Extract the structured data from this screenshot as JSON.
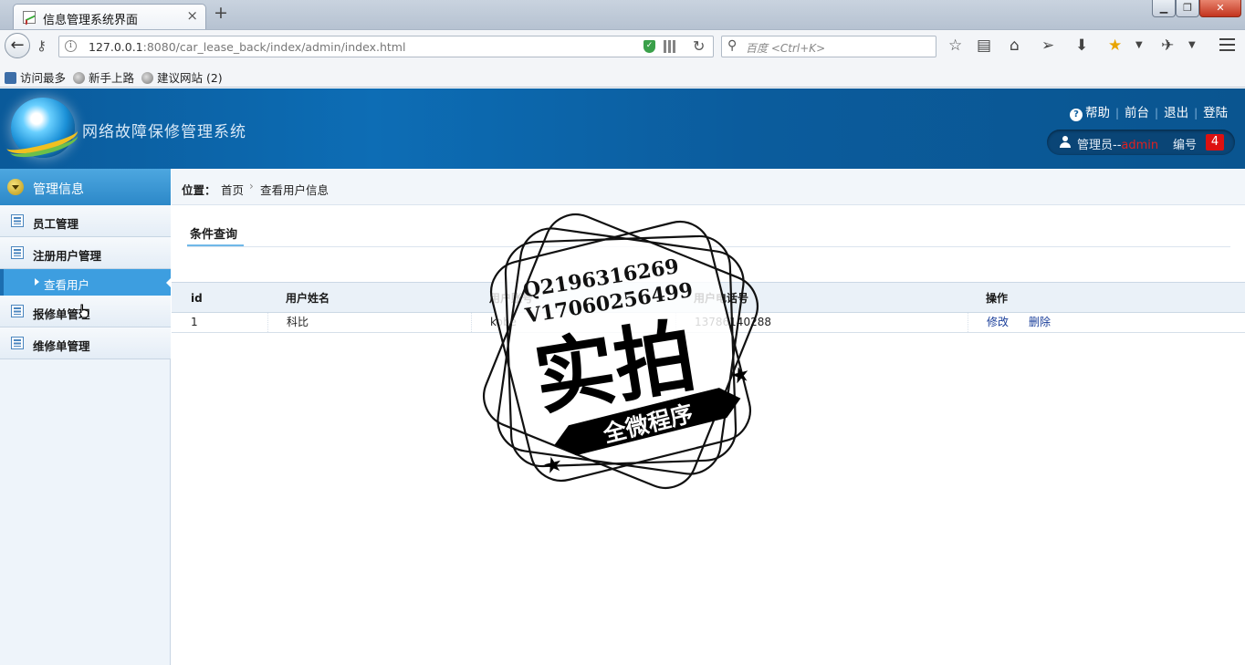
{
  "browser": {
    "tab_title": "信息管理系统界面",
    "tab_close": "×",
    "new_tab": "+",
    "url_host": "127.0.0.1",
    "url_rest": ":8080/car_lease_back/index/admin/index.html",
    "search_placeholder": "百度 <Ctrl+K>",
    "bookmarks": [
      "访问最多",
      "新手上路",
      "建议网站 (2)"
    ]
  },
  "header": {
    "title": "网络故障保修管理系统",
    "links": [
      "帮助",
      "前台",
      "退出",
      "登陆"
    ],
    "user_role": "管理员--",
    "user_name": "admin",
    "user_number_label": "编号",
    "user_number": "4"
  },
  "sidebar": {
    "title": "管理信息",
    "items": [
      {
        "label": "员工管理"
      },
      {
        "label": "注册用户管理"
      },
      {
        "label": "报修单管理"
      },
      {
        "label": "维修单管理"
      }
    ],
    "active_sub": "查看用户"
  },
  "breadcrumb": {
    "label": "位置：",
    "home": "首页",
    "separator": "›",
    "current": "查看用户信息"
  },
  "query": {
    "tab_label": "条件查询"
  },
  "table": {
    "columns": [
      "id",
      "用户姓名",
      "用户账号",
      "用户电话号",
      "操作"
    ],
    "rows": [
      {
        "id": "1",
        "name": "科比",
        "account": "kobe",
        "phone": "13786140288",
        "edit": "修改",
        "delete": "删除"
      }
    ]
  },
  "watermark": {
    "line1": "Q2196316269",
    "line2": "V17060256499",
    "main": "实拍",
    "banner": "全微程序"
  }
}
